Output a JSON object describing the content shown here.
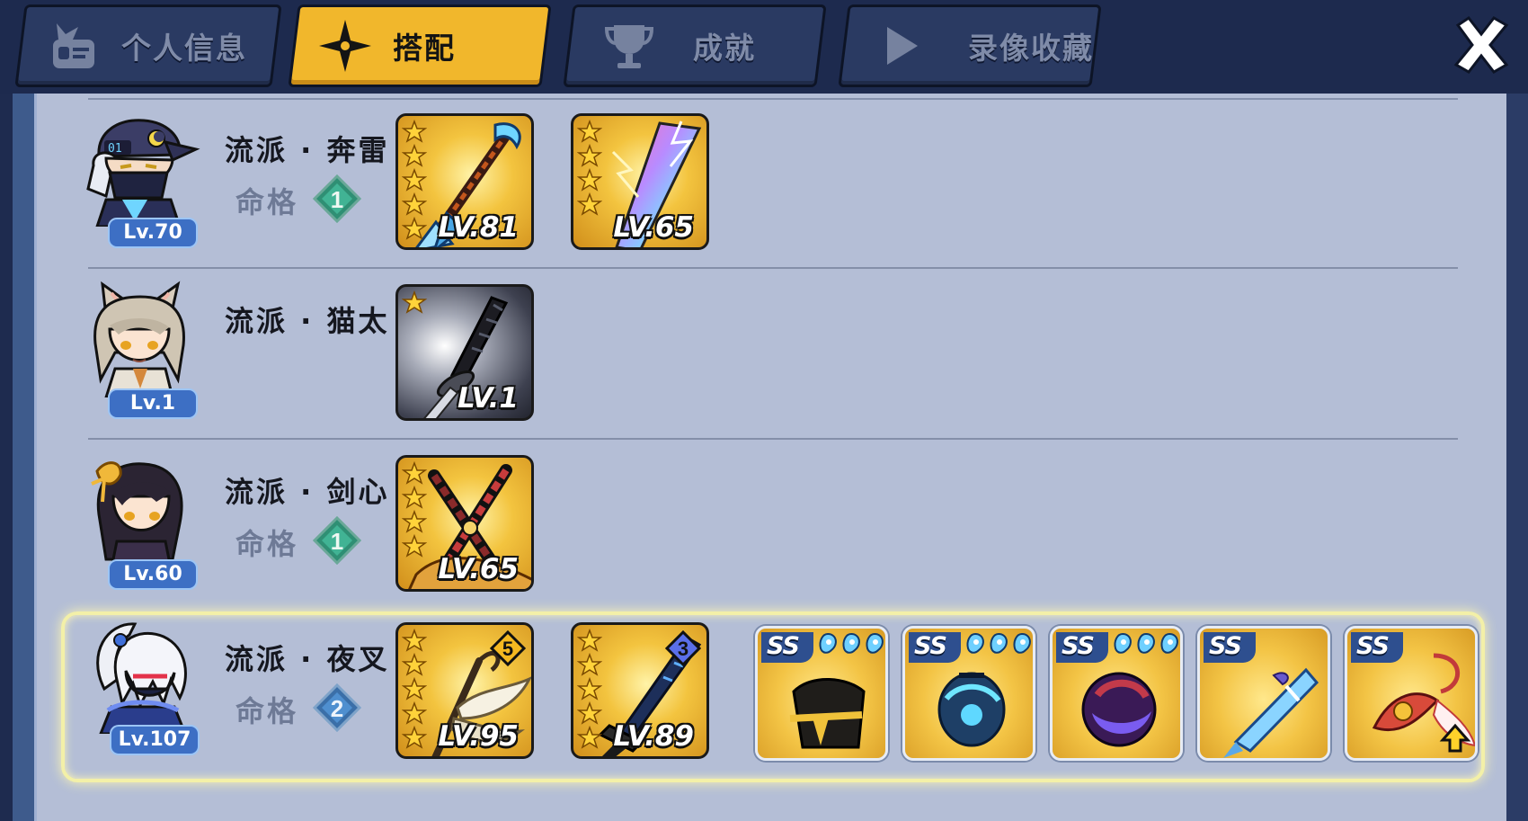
{
  "tabs": [
    {
      "label": "个人信息",
      "icon": "profile-card-icon",
      "active": false
    },
    {
      "label": "搭配",
      "icon": "shuriken-icon",
      "active": true
    },
    {
      "label": "成就",
      "icon": "trophy-icon",
      "active": false
    },
    {
      "label": "录像收藏",
      "icon": "play-icon",
      "active": false
    }
  ],
  "close_icon": "close-icon",
  "colors": {
    "active_tab": "#f1b72c",
    "panel": "#b4bed6",
    "badge": "#3d6fc4",
    "highlight": "#f3f0a8"
  },
  "builds": [
    {
      "school": "流派 · 奔雷",
      "level": "Lv.70",
      "fate_label": "命格",
      "fate_rank": "1",
      "weapons": [
        {
          "level": "LV.81",
          "stars": 5,
          "icon": "spear-icon"
        },
        {
          "level": "LV.65",
          "stars": 4,
          "icon": "lightning-blade-icon"
        }
      ]
    },
    {
      "school": "流派 · 猫太",
      "level": "Lv.1",
      "weapons": [
        {
          "level": "LV.1",
          "stars": 1,
          "icon": "katana-icon"
        }
      ]
    },
    {
      "school": "流派 · 剑心",
      "level": "Lv.60",
      "fate_label": "命格",
      "fate_rank": "1",
      "weapons": [
        {
          "level": "LV.65",
          "stars": 4,
          "icon": "twin-blades-icon"
        }
      ]
    },
    {
      "school": "流派 · 夜叉",
      "level": "Lv.107",
      "fate_label": "命格",
      "fate_rank": "2",
      "selected": true,
      "weapons": [
        {
          "level": "LV.95",
          "stars": 5,
          "rank": "5",
          "icon": "feather-sword-icon"
        },
        {
          "level": "LV.89",
          "stars": 5,
          "rank": "3",
          "icon": "dark-sword-icon"
        }
      ],
      "relics": [
        {
          "grade": "SS",
          "orbs": 3,
          "icon": "scroll-relic-icon"
        },
        {
          "grade": "SS",
          "orbs": 3,
          "icon": "lantern-relic-icon"
        },
        {
          "grade": "SS",
          "orbs": 3,
          "icon": "crescent-orb-relic-icon"
        },
        {
          "grade": "SS",
          "orbs": 0,
          "icon": "crystal-relic-icon"
        },
        {
          "grade": "SS",
          "orbs": 0,
          "icon": "ribbon-bell-relic-icon",
          "upgrade_arrow": true
        }
      ]
    }
  ]
}
